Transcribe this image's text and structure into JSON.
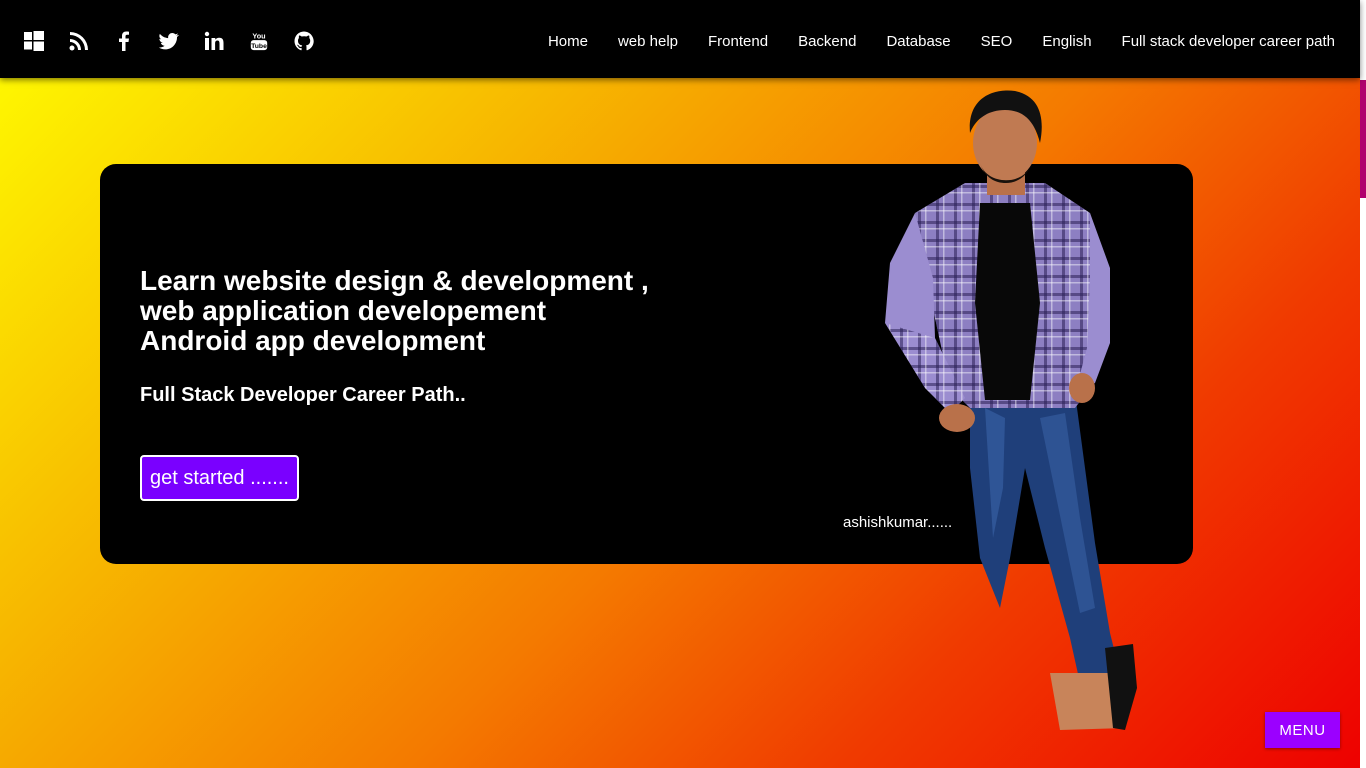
{
  "social": [
    {
      "name": "windows-icon"
    },
    {
      "name": "rss-icon"
    },
    {
      "name": "facebook-icon"
    },
    {
      "name": "twitter-icon"
    },
    {
      "name": "linkedin-icon"
    },
    {
      "name": "youtube-icon",
      "label_top": "You",
      "label_bottom": "Tube"
    },
    {
      "name": "github-icon"
    }
  ],
  "nav": {
    "items": [
      "Home",
      "web help",
      "Frontend",
      "Backend",
      "Database",
      "SEO",
      "English",
      "Full stack developer career path"
    ]
  },
  "hero": {
    "headline_lines": [
      "Learn website design & development ,",
      "web application developement",
      "Android app development"
    ],
    "subheading": "Full Stack Developer Career Path..",
    "cta_label": "get started .......",
    "caption": "ashishkumar......"
  },
  "menu_button": {
    "label": "MENU"
  },
  "colors": {
    "topbar": "#000000",
    "card": "#000000",
    "cta_bg": "#7a00ff",
    "menu_bg": "#9b00ff",
    "gradient_start": "#ffff00",
    "gradient_end": "#ee0000"
  }
}
